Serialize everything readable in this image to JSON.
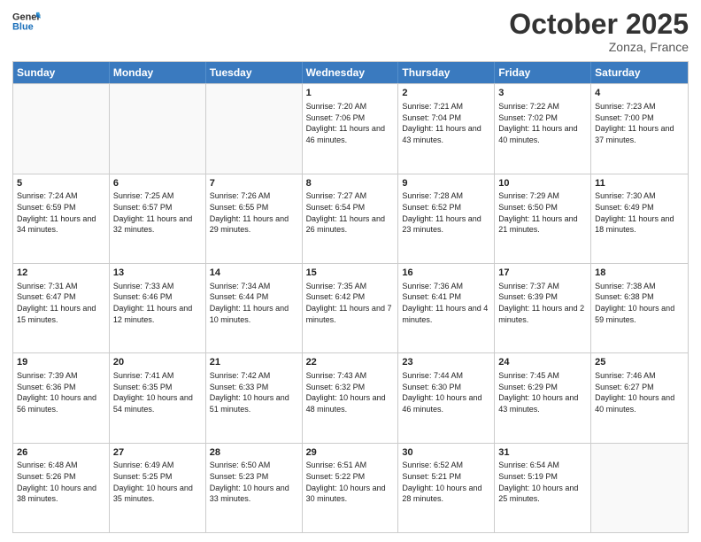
{
  "header": {
    "logo_general": "General",
    "logo_blue": "Blue",
    "month": "October 2025",
    "location": "Zonza, France"
  },
  "days_of_week": [
    "Sunday",
    "Monday",
    "Tuesday",
    "Wednesday",
    "Thursday",
    "Friday",
    "Saturday"
  ],
  "weeks": [
    [
      {
        "day": "",
        "empty": true
      },
      {
        "day": "",
        "empty": true
      },
      {
        "day": "",
        "empty": true
      },
      {
        "day": "1",
        "sunrise": "7:20 AM",
        "sunset": "7:06 PM",
        "daylight": "11 hours and 46 minutes."
      },
      {
        "day": "2",
        "sunrise": "7:21 AM",
        "sunset": "7:04 PM",
        "daylight": "11 hours and 43 minutes."
      },
      {
        "day": "3",
        "sunrise": "7:22 AM",
        "sunset": "7:02 PM",
        "daylight": "11 hours and 40 minutes."
      },
      {
        "day": "4",
        "sunrise": "7:23 AM",
        "sunset": "7:00 PM",
        "daylight": "11 hours and 37 minutes."
      }
    ],
    [
      {
        "day": "5",
        "sunrise": "7:24 AM",
        "sunset": "6:59 PM",
        "daylight": "11 hours and 34 minutes."
      },
      {
        "day": "6",
        "sunrise": "7:25 AM",
        "sunset": "6:57 PM",
        "daylight": "11 hours and 32 minutes."
      },
      {
        "day": "7",
        "sunrise": "7:26 AM",
        "sunset": "6:55 PM",
        "daylight": "11 hours and 29 minutes."
      },
      {
        "day": "8",
        "sunrise": "7:27 AM",
        "sunset": "6:54 PM",
        "daylight": "11 hours and 26 minutes."
      },
      {
        "day": "9",
        "sunrise": "7:28 AM",
        "sunset": "6:52 PM",
        "daylight": "11 hours and 23 minutes."
      },
      {
        "day": "10",
        "sunrise": "7:29 AM",
        "sunset": "6:50 PM",
        "daylight": "11 hours and 21 minutes."
      },
      {
        "day": "11",
        "sunrise": "7:30 AM",
        "sunset": "6:49 PM",
        "daylight": "11 hours and 18 minutes."
      }
    ],
    [
      {
        "day": "12",
        "sunrise": "7:31 AM",
        "sunset": "6:47 PM",
        "daylight": "11 hours and 15 minutes."
      },
      {
        "day": "13",
        "sunrise": "7:33 AM",
        "sunset": "6:46 PM",
        "daylight": "11 hours and 12 minutes."
      },
      {
        "day": "14",
        "sunrise": "7:34 AM",
        "sunset": "6:44 PM",
        "daylight": "11 hours and 10 minutes."
      },
      {
        "day": "15",
        "sunrise": "7:35 AM",
        "sunset": "6:42 PM",
        "daylight": "11 hours and 7 minutes."
      },
      {
        "day": "16",
        "sunrise": "7:36 AM",
        "sunset": "6:41 PM",
        "daylight": "11 hours and 4 minutes."
      },
      {
        "day": "17",
        "sunrise": "7:37 AM",
        "sunset": "6:39 PM",
        "daylight": "11 hours and 2 minutes."
      },
      {
        "day": "18",
        "sunrise": "7:38 AM",
        "sunset": "6:38 PM",
        "daylight": "10 hours and 59 minutes."
      }
    ],
    [
      {
        "day": "19",
        "sunrise": "7:39 AM",
        "sunset": "6:36 PM",
        "daylight": "10 hours and 56 minutes."
      },
      {
        "day": "20",
        "sunrise": "7:41 AM",
        "sunset": "6:35 PM",
        "daylight": "10 hours and 54 minutes."
      },
      {
        "day": "21",
        "sunrise": "7:42 AM",
        "sunset": "6:33 PM",
        "daylight": "10 hours and 51 minutes."
      },
      {
        "day": "22",
        "sunrise": "7:43 AM",
        "sunset": "6:32 PM",
        "daylight": "10 hours and 48 minutes."
      },
      {
        "day": "23",
        "sunrise": "7:44 AM",
        "sunset": "6:30 PM",
        "daylight": "10 hours and 46 minutes."
      },
      {
        "day": "24",
        "sunrise": "7:45 AM",
        "sunset": "6:29 PM",
        "daylight": "10 hours and 43 minutes."
      },
      {
        "day": "25",
        "sunrise": "7:46 AM",
        "sunset": "6:27 PM",
        "daylight": "10 hours and 40 minutes."
      }
    ],
    [
      {
        "day": "26",
        "sunrise": "6:48 AM",
        "sunset": "5:26 PM",
        "daylight": "10 hours and 38 minutes."
      },
      {
        "day": "27",
        "sunrise": "6:49 AM",
        "sunset": "5:25 PM",
        "daylight": "10 hours and 35 minutes."
      },
      {
        "day": "28",
        "sunrise": "6:50 AM",
        "sunset": "5:23 PM",
        "daylight": "10 hours and 33 minutes."
      },
      {
        "day": "29",
        "sunrise": "6:51 AM",
        "sunset": "5:22 PM",
        "daylight": "10 hours and 30 minutes."
      },
      {
        "day": "30",
        "sunrise": "6:52 AM",
        "sunset": "5:21 PM",
        "daylight": "10 hours and 28 minutes."
      },
      {
        "day": "31",
        "sunrise": "6:54 AM",
        "sunset": "5:19 PM",
        "daylight": "10 hours and 25 minutes."
      },
      {
        "day": "",
        "empty": true
      }
    ]
  ],
  "labels": {
    "sunrise": "Sunrise:",
    "sunset": "Sunset:",
    "daylight": "Daylight:"
  }
}
